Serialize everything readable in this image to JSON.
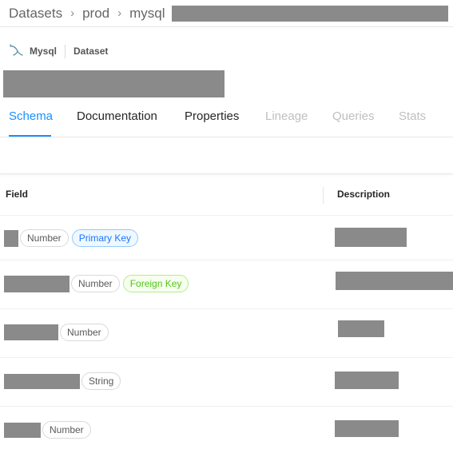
{
  "breadcrumb": {
    "items": [
      "Datasets",
      "prod",
      "mysql"
    ]
  },
  "entity": {
    "platform": "Mysql",
    "type": "Dataset"
  },
  "tabs": [
    {
      "label": "Schema",
      "state": "active"
    },
    {
      "label": "Documentation",
      "state": "normal"
    },
    {
      "label": "Properties",
      "state": "normal"
    },
    {
      "label": "Lineage",
      "state": "disabled"
    },
    {
      "label": "Queries",
      "state": "disabled"
    },
    {
      "label": "Stats",
      "state": "disabled"
    }
  ],
  "table": {
    "columns": [
      "Field",
      "Description"
    ],
    "rows": [
      {
        "type": "Number",
        "key_badge": "Primary Key"
      },
      {
        "type": "Number",
        "key_badge": "Foreign Key"
      },
      {
        "type": "Number",
        "key_badge": ""
      },
      {
        "type": "String",
        "key_badge": ""
      },
      {
        "type": "Number",
        "key_badge": ""
      }
    ]
  },
  "colors": {
    "accent": "#1890ff",
    "primary_key": "#1677ff",
    "foreign_key": "#52c41a",
    "redaction": "#8a8a8a"
  },
  "icons": {
    "platform": "mysql-dolphin-icon",
    "separator": "chevron-right-icon"
  }
}
